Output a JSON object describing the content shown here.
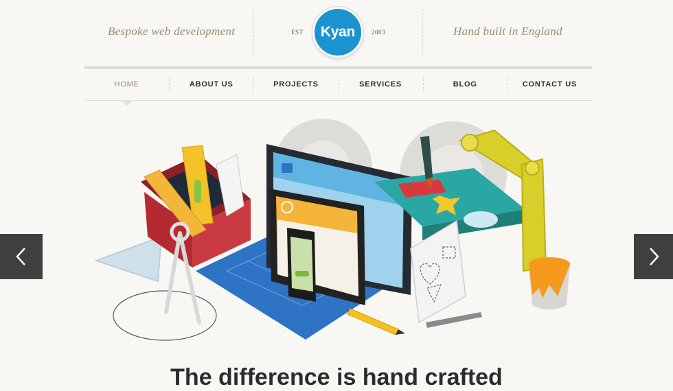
{
  "header": {
    "tagline_left": "Bespoke web development",
    "tagline_right": "Hand built in England",
    "est_label": "EST",
    "year": "2003",
    "logo_text": "Kyan"
  },
  "nav": {
    "items": [
      {
        "label": "HOME",
        "active": true
      },
      {
        "label": "ABOUT US"
      },
      {
        "label": "PROJECTS"
      },
      {
        "label": "SERVICES"
      },
      {
        "label": "BLOG"
      },
      {
        "label": "CONTACT US"
      }
    ]
  },
  "hero": {
    "heading": "The difference is hand crafted"
  },
  "colors": {
    "brand_blue": "#1c93d1",
    "accent_tan": "#9a8c6c",
    "toolbox_red": "#b52a32",
    "robot_yellow": "#d9cf2a",
    "conveyor_teal": "#2aa7a2",
    "blueprint_blue": "#2f73c4"
  },
  "icons": {
    "prev": "chevron-left-icon",
    "next": "chevron-right-icon"
  }
}
